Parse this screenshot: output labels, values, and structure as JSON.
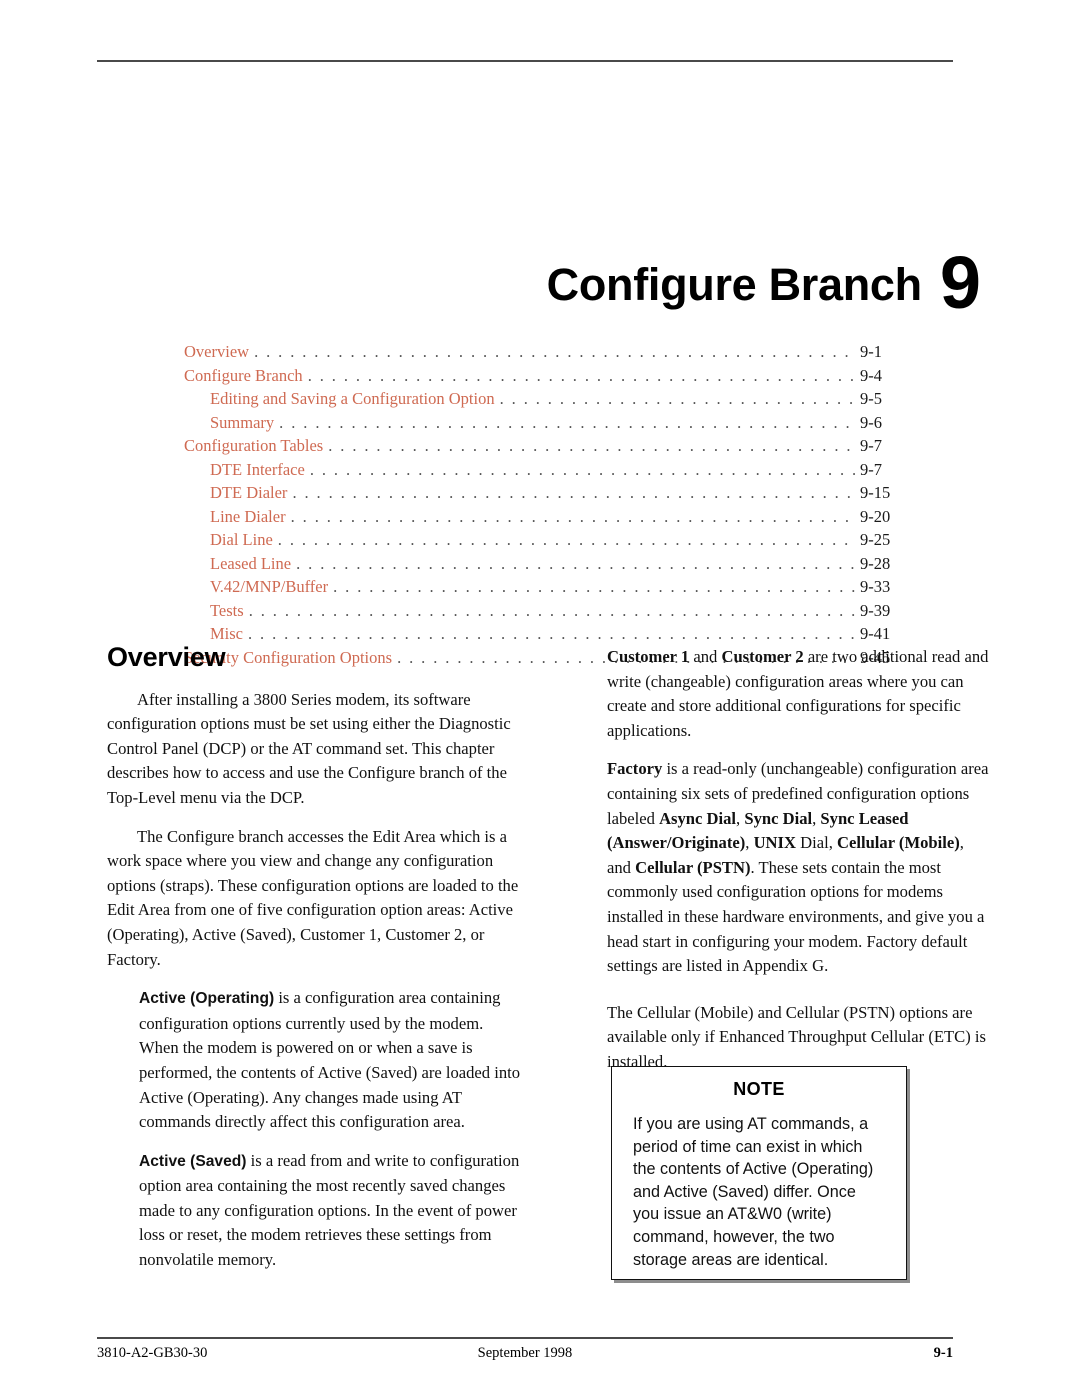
{
  "chapter": {
    "title": "Configure Branch",
    "number": "9"
  },
  "toc": {
    "entries": [
      {
        "label": "Overview",
        "page": "9-1",
        "level": 1
      },
      {
        "label": "Configure Branch",
        "page": "9-4",
        "level": 1
      },
      {
        "label": "Editing and Saving a Configuration Option",
        "page": "9-5",
        "level": 2
      },
      {
        "label": "Summary",
        "page": "9-6",
        "level": 2
      },
      {
        "label": "Configuration Tables",
        "page": "9-7",
        "level": 1
      },
      {
        "label": "DTE Interface",
        "page": "9-7",
        "level": 2
      },
      {
        "label": "DTE Dialer",
        "page": "9-15",
        "level": 2
      },
      {
        "label": "Line Dialer",
        "page": "9-20",
        "level": 2
      },
      {
        "label": "Dial Line",
        "page": "9-25",
        "level": 2
      },
      {
        "label": "Leased Line",
        "page": "9-28",
        "level": 2
      },
      {
        "label": "V.42/MNP/Buffer",
        "page": "9-33",
        "level": 2
      },
      {
        "label": "Tests",
        "page": "9-39",
        "level": 2
      },
      {
        "label": "Misc",
        "page": "9-41",
        "level": 2
      },
      {
        "label": "Security Configuration Options",
        "page": "9-45",
        "level": 1
      }
    ],
    "dot_leader": ". . . . . . . . . . . . . . . . . . . . . . . . . . . . . . . . . . . . . . . . . . . . . . . . . . . . . . . . . . . . . . . . . . . . . . . . . . . . . . . . . . . . . . . . . . . . . . . . . . . . . . . . . . . . . . . . . . . . . . . . . . . . . . . . . . . . . . . . . . . . . . . . . . ."
  },
  "left_column": {
    "heading": "Overview",
    "para1": "After installing a 3800 Series modem, its software configuration options must be set using either the Diagnostic Control Panel (DCP) or the AT command set. This chapter describes how to access and use the Configure branch of the Top-Level menu via the DCP.",
    "para2": "The Configure branch accesses the Edit Area which is a work space where you view and change any configuration options (straps). These configuration options are loaded to the Edit Area from one of five configuration option areas: Active (Operating), Active (Saved), Customer 1, Customer 2, or Factory.",
    "para3_bold": "Active (Operating)",
    "para3_rest": " is a configuration area containing configuration options currently used by the modem. When the modem is powered on or when a save is performed, the contents of Active (Saved) are loaded into Active (Operating). Any changes made using AT commands directly affect this configuration area.",
    "para4_bold": "Active (Saved)",
    "para4_rest": " is a read from and write to configuration option area containing the most recently saved changes made to any configuration options. In the event of power loss or reset, the modem retrieves these settings from nonvolatile memory."
  },
  "right_column": {
    "para1_b1": "Customer 1",
    "para1_mid": " and ",
    "para1_b2": "Customer 2",
    "para1_rest": " are two additional read and write (changeable) configuration areas where you can create and store additional configurations for specific applications.",
    "para2_b1": "Factory",
    "para2_t1": " is a read-only (unchangeable) configuration area containing six sets of predefined configuration options labeled ",
    "para2_b2": "Async Dial",
    "para2_t2": ", ",
    "para2_b3": "Sync Dial",
    "para2_t3": ", ",
    "para2_b4": "Sync Leased (Answer/Originate)",
    "para2_t4": ", ",
    "para2_b5": "UNIX",
    "para2_t5": " Dial, ",
    "para2_b6": "Cellular (Mobile)",
    "para2_t6": ", and ",
    "para2_b7": "Cellular (PSTN)",
    "para2_t7": ". These sets contain the most commonly used configuration options for modems installed in these hardware environments, and give you a head start in configuring your modem. Factory default settings are listed in Appendix G.",
    "para3": "The Cellular (Mobile) and Cellular (PSTN) options are available only if Enhanced Throughput Cellular (ETC) is installed."
  },
  "note": {
    "title": "NOTE",
    "body": "If you are using AT commands, a period of time can exist in which the contents of Active (Operating) and Active (Saved) differ. Once you issue an AT&W0 (write) command, however, the two storage areas are identical."
  },
  "footer": {
    "doc_number": "3810-A2-GB30-30",
    "date": "September 1998",
    "page_number": "9-1"
  },
  "colors": {
    "toc_text": "#cf6a52",
    "rule": "#4a4a4a",
    "note_shadow": "#8d8d8d"
  }
}
